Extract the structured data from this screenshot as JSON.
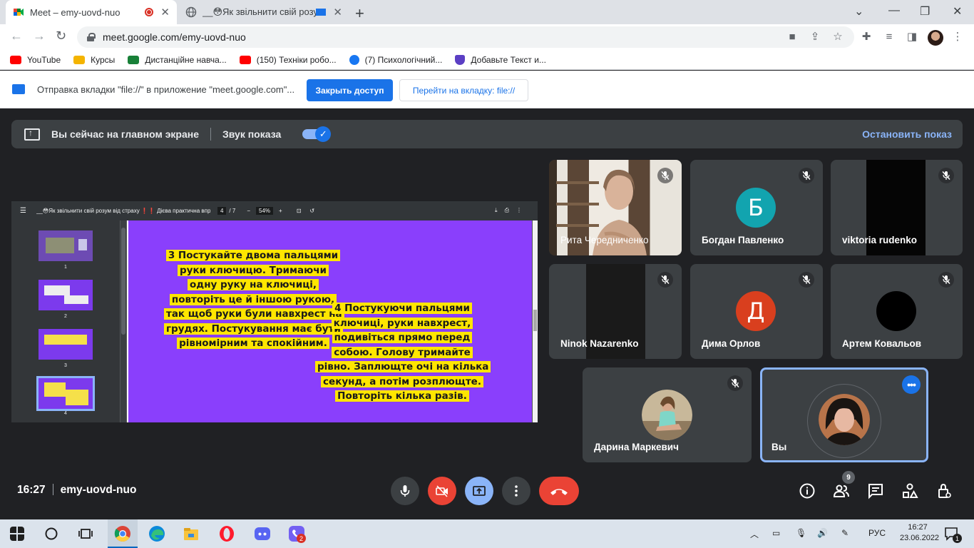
{
  "browser": {
    "tabs": [
      {
        "title": "Meet – emy-uovd-nuo",
        "active": true
      },
      {
        "title": "__😳Як звільнити свій розу",
        "active": false
      }
    ],
    "new_tab": "+",
    "url": "meet.google.com/emy-uovd-nuo",
    "bookmarks": [
      {
        "label": "YouTube",
        "color": "#ff0000"
      },
      {
        "label": "Курсы",
        "color": "#f4b400"
      },
      {
        "label": "Дистанційне навча...",
        "color": "#188038"
      },
      {
        "label": "(150) Техніки робо...",
        "color": "#ff0000"
      },
      {
        "label": "(7) Психологічний...",
        "color": "#1877f2"
      },
      {
        "label": "Добавьте Текст и...",
        "color": "#5b3fc4"
      }
    ],
    "infobar": {
      "message": "Отправка вкладки \"file://\" в приложение \"meet.google.com\"...",
      "primary": "Закрыть доступ",
      "secondary": "Перейти на вкладку: file://"
    }
  },
  "meet": {
    "presentation_bar": {
      "status": "Вы сейчас на главном экране",
      "sound_label": "Звук показа",
      "stop_label": "Остановить показ"
    },
    "shared_pdf": {
      "title": "__😳Як звільнити свій розум від страху ❗❗ Дієва практична вправ...",
      "page_current": "4",
      "page_total": "/ 7",
      "zoom": "54%",
      "thumb_numbers": [
        "1",
        "2",
        "3",
        "4"
      ],
      "slide_text_3": "3  Постукайте двома пальцями руки ключицю. Тримаючи одну руку на ключиці, повторіть це й іншою рукою, так щоб руки були навхрест на грудях. Постукування має бути рівномірним та спокійним.",
      "slide_text_4": "4  Постукуючи пальцями ключиці, руки навхрест, подивіться прямо перед собою. Голову тримайте рівно. Заплющте очі на кілька секунд, а потім розплющте. Повторіть кілька разів.",
      "slide_color": "#8a3ffc",
      "highlight_color": "#ffe600"
    },
    "participants": [
      {
        "name": "Рита Чередниченко",
        "kind": "video"
      },
      {
        "name": "Богдан Павленко",
        "kind": "letter",
        "letter": "Б",
        "color": "#12a4af"
      },
      {
        "name": "viktoria rudenko",
        "kind": "dark"
      },
      {
        "name": "Ninok Nazarenko",
        "kind": "dark"
      },
      {
        "name": "Дима Орлов",
        "kind": "letter",
        "letter": "Д",
        "color": "#d93f1e"
      },
      {
        "name": "Артем Ковальов",
        "kind": "black-circle"
      },
      {
        "name": "Дарина Маркевич",
        "kind": "photo"
      },
      {
        "name": "Вы",
        "kind": "self-photo"
      }
    ],
    "meeting_time": "16:27",
    "meeting_code": "emy-uovd-nuo",
    "people_count": "9"
  },
  "taskbar": {
    "language": "РУС",
    "time": "16:27",
    "date": "23.06.2022",
    "notif_count": "1",
    "viber_badge": "2"
  }
}
